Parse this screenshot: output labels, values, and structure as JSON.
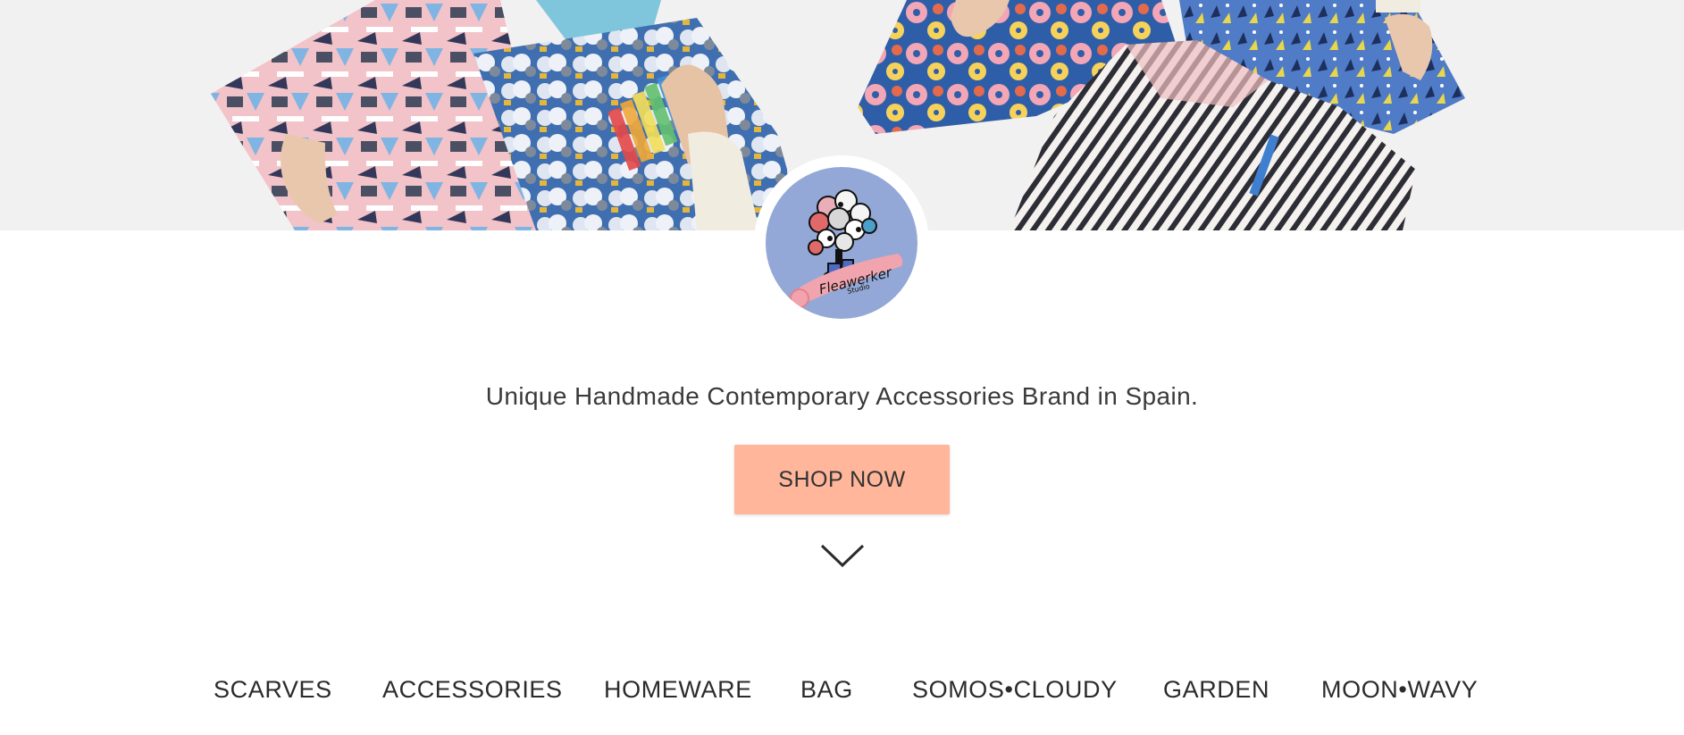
{
  "hero": {
    "image_description_icon": "pillows-photo"
  },
  "logo": {
    "brand_script": "Fleawerker",
    "sub": "Studio",
    "disc_color": "#93a8d6",
    "ribbon_color": "#f1a4ae"
  },
  "tagline": "Unique Handmade Contemporary Accessories Brand in Spain.",
  "shop_button": {
    "label": "SHOP NOW",
    "color": "#ffb69a"
  },
  "scroll_icon": "chevron-down-icon",
  "categories": [
    {
      "label": "SCARVES"
    },
    {
      "label": "ACCESSORIES"
    },
    {
      "label": "HOMEWARE"
    },
    {
      "label": "BAG"
    },
    {
      "label": "SOMOS•CLOUDY"
    },
    {
      "label": "GARDEN"
    },
    {
      "label": "MOON•WAVY"
    }
  ]
}
